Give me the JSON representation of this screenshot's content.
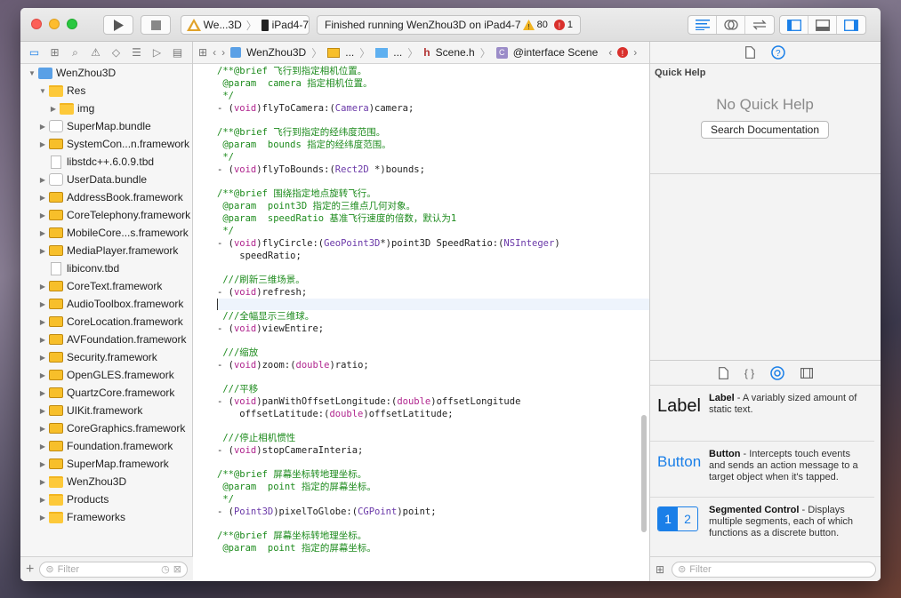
{
  "toolbar": {
    "scheme": "We...3D",
    "device": "iPad4-7",
    "activity": "Finished running WenZhou3D on iPad4-7",
    "warnings": "80",
    "errors": "1"
  },
  "navigator": {
    "items": [
      {
        "label": "WenZhou3D",
        "level": 0,
        "disclosure": "open",
        "icon": "project-icon"
      },
      {
        "label": "Res",
        "level": 1,
        "disclosure": "open",
        "icon": "folder-icon"
      },
      {
        "label": "img",
        "level": 2,
        "disclosure": "closed",
        "icon": "folder-icon"
      },
      {
        "label": "SuperMap.bundle",
        "level": 1,
        "disclosure": "closed",
        "icon": "bundle-icon"
      },
      {
        "label": "SystemCon...n.framework",
        "level": 1,
        "disclosure": "closed",
        "icon": "framework-icon"
      },
      {
        "label": "libstdc++.6.0.9.tbd",
        "level": 1,
        "disclosure": "none",
        "icon": "document-icon"
      },
      {
        "label": "UserData.bundle",
        "level": 1,
        "disclosure": "closed",
        "icon": "bundle-icon"
      },
      {
        "label": "AddressBook.framework",
        "level": 1,
        "disclosure": "closed",
        "icon": "framework-icon"
      },
      {
        "label": "CoreTelephony.framework",
        "level": 1,
        "disclosure": "closed",
        "icon": "framework-icon"
      },
      {
        "label": "MobileCore...s.framework",
        "level": 1,
        "disclosure": "closed",
        "icon": "framework-icon"
      },
      {
        "label": "MediaPlayer.framework",
        "level": 1,
        "disclosure": "closed",
        "icon": "framework-icon"
      },
      {
        "label": "libiconv.tbd",
        "level": 1,
        "disclosure": "none",
        "icon": "document-icon"
      },
      {
        "label": "CoreText.framework",
        "level": 1,
        "disclosure": "closed",
        "icon": "framework-icon"
      },
      {
        "label": "AudioToolbox.framework",
        "level": 1,
        "disclosure": "closed",
        "icon": "framework-icon"
      },
      {
        "label": "CoreLocation.framework",
        "level": 1,
        "disclosure": "closed",
        "icon": "framework-icon"
      },
      {
        "label": "AVFoundation.framework",
        "level": 1,
        "disclosure": "closed",
        "icon": "framework-icon"
      },
      {
        "label": "Security.framework",
        "level": 1,
        "disclosure": "closed",
        "icon": "framework-icon"
      },
      {
        "label": "OpenGLES.framework",
        "level": 1,
        "disclosure": "closed",
        "icon": "framework-icon"
      },
      {
        "label": "QuartzCore.framework",
        "level": 1,
        "disclosure": "closed",
        "icon": "framework-icon"
      },
      {
        "label": "UIKit.framework",
        "level": 1,
        "disclosure": "closed",
        "icon": "framework-icon"
      },
      {
        "label": "CoreGraphics.framework",
        "level": 1,
        "disclosure": "closed",
        "icon": "framework-icon"
      },
      {
        "label": "Foundation.framework",
        "level": 1,
        "disclosure": "closed",
        "icon": "framework-icon"
      },
      {
        "label": "SuperMap.framework",
        "level": 1,
        "disclosure": "closed",
        "icon": "framework-icon"
      },
      {
        "label": "WenZhou3D",
        "level": 1,
        "disclosure": "closed",
        "icon": "folder-icon"
      },
      {
        "label": "Products",
        "level": 1,
        "disclosure": "closed",
        "icon": "folder-icon"
      },
      {
        "label": "Frameworks",
        "level": 1,
        "disclosure": "closed",
        "icon": "folder-icon"
      }
    ],
    "filter_placeholder": "Filter"
  },
  "jumpbar": {
    "project": "WenZhou3D",
    "crumb2": "...",
    "crumb3": "...",
    "file": "Scene.h",
    "symbol": "@interface Scene"
  },
  "code": [
    [
      [
        "c",
        "/**@brief 飞行到指定相机位置。"
      ]
    ],
    [
      [
        "c",
        " @param  camera 指定相机位置。"
      ]
    ],
    [
      [
        "c",
        " */"
      ]
    ],
    [
      [
        "p",
        "- ("
      ],
      [
        "k",
        "void"
      ],
      [
        "p",
        ")flyToCamera:("
      ],
      [
        "t",
        "Camera"
      ],
      [
        "p",
        ")camera;"
      ]
    ],
    [],
    [
      [
        "c",
        "/**@brief 飞行到指定的经纬度范围。"
      ]
    ],
    [
      [
        "c",
        " @param  bounds 指定的经纬度范围。"
      ]
    ],
    [
      [
        "c",
        " */"
      ]
    ],
    [
      [
        "p",
        "- ("
      ],
      [
        "k",
        "void"
      ],
      [
        "p",
        ")flyToBounds:("
      ],
      [
        "t",
        "Rect2D"
      ],
      [
        "p",
        " *)bounds;"
      ]
    ],
    [],
    [
      [
        "c",
        "/**@brief 围绕指定地点旋转飞行。"
      ]
    ],
    [
      [
        "c",
        " @param  point3D 指定的三维点几何对象。"
      ]
    ],
    [
      [
        "c",
        " @param  speedRatio 基准飞行速度的倍数，默认为1"
      ]
    ],
    [
      [
        "c",
        " */"
      ]
    ],
    [
      [
        "p",
        "- ("
      ],
      [
        "k",
        "void"
      ],
      [
        "p",
        ")flyCircle:("
      ],
      [
        "t",
        "GeoPoint3D"
      ],
      [
        "p",
        "*)point3D SpeedRatio:("
      ],
      [
        "t",
        "NSInteger"
      ],
      [
        "p",
        ")"
      ]
    ],
    [
      [
        "p",
        "    speedRatio;"
      ]
    ],
    [],
    [
      [
        "c",
        " ///刷新三维场景。"
      ]
    ],
    [
      [
        "p",
        "- ("
      ],
      [
        "k",
        "void"
      ],
      [
        "p",
        ")refresh;"
      ]
    ],
    [],
    [
      [
        "c",
        " ///全幅显示三维球。"
      ]
    ],
    [
      [
        "p",
        "- ("
      ],
      [
        "k",
        "void"
      ],
      [
        "p",
        ")viewEntire;"
      ]
    ],
    [],
    [
      [
        "c",
        " ///缩放"
      ]
    ],
    [
      [
        "p",
        "- ("
      ],
      [
        "k",
        "void"
      ],
      [
        "p",
        ")zoom:("
      ],
      [
        "k",
        "double"
      ],
      [
        "p",
        ")ratio;"
      ]
    ],
    [],
    [
      [
        "c",
        " ///平移"
      ]
    ],
    [
      [
        "p",
        "- ("
      ],
      [
        "k",
        "void"
      ],
      [
        "p",
        ")panWithOffsetLongitude:("
      ],
      [
        "k",
        "double"
      ],
      [
        "p",
        ")offsetLongitude"
      ]
    ],
    [
      [
        "p",
        "    offsetLatitude:("
      ],
      [
        "k",
        "double"
      ],
      [
        "p",
        ")offsetLatitude;"
      ]
    ],
    [],
    [
      [
        "c",
        " ///停止相机惯性"
      ]
    ],
    [
      [
        "p",
        "- ("
      ],
      [
        "k",
        "void"
      ],
      [
        "p",
        ")stopCameraInteria;"
      ]
    ],
    [],
    [
      [
        "c",
        "/**@brief 屏幕坐标转地理坐标。"
      ]
    ],
    [
      [
        "c",
        " @param  point 指定的屏幕坐标。"
      ]
    ],
    [
      [
        "c",
        " */"
      ]
    ],
    [
      [
        "p",
        "- ("
      ],
      [
        "t",
        "Point3D"
      ],
      [
        "p",
        ")pixelToGlobe:("
      ],
      [
        "t",
        "CGPoint"
      ],
      [
        "p",
        ")point;"
      ]
    ],
    [],
    [
      [
        "c",
        "/**@brief 屏幕坐标转地理坐标。"
      ]
    ],
    [
      [
        "c",
        " @param  point 指定的屏幕坐标。"
      ]
    ]
  ],
  "inspector": {
    "section_title": "Quick Help",
    "empty_text": "No Quick Help",
    "search_button": "Search Documentation"
  },
  "library": {
    "items": [
      {
        "icon_text": "Label",
        "name": "Label",
        "desc": " - A variably sized amount of static text."
      },
      {
        "icon_text": "Button",
        "name": "Button",
        "desc": " - Intercepts touch events and sends an action message to a target object when it's tapped."
      },
      {
        "icon_text": "",
        "name": "Segmented Control",
        "desc": " - Displays multiple segments, each of which functions as a discrete button."
      }
    ],
    "segment_labels": [
      "1",
      "2"
    ],
    "filter_placeholder": "Filter"
  },
  "colors": {
    "accent": "#1a7fe8",
    "comment": "#1d8b1d",
    "keyword": "#b0258e",
    "type": "#6a38a8",
    "folder": "#fdc93a",
    "error": "#d9302c",
    "warning": "#f1b422"
  }
}
